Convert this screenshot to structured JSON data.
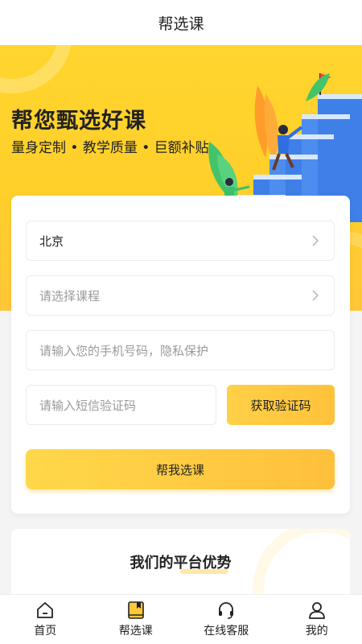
{
  "topbar": {
    "title": "帮选课"
  },
  "hero": {
    "title": "帮您甄选好课",
    "subtitle": "量身定制 • 教学质量 • 巨额补贴"
  },
  "form": {
    "city_value": "北京",
    "course_placeholder": "请选择课程",
    "phone_placeholder": "请输入您的手机号码，隐私保护",
    "code_placeholder": "请输入短信验证码",
    "get_code_label": "获取验证码",
    "submit_label": "帮我选课"
  },
  "advantages": {
    "title": "我们的平台优势"
  },
  "tabbar": {
    "items": [
      {
        "label": "首页",
        "icon": "home-icon"
      },
      {
        "label": "帮选课",
        "icon": "book-icon"
      },
      {
        "label": "在线客服",
        "icon": "headset-icon"
      },
      {
        "label": "我的",
        "icon": "user-icon"
      }
    ]
  },
  "colors": {
    "accent": "#ffc83a",
    "hero_bg": "#ffd52e"
  }
}
